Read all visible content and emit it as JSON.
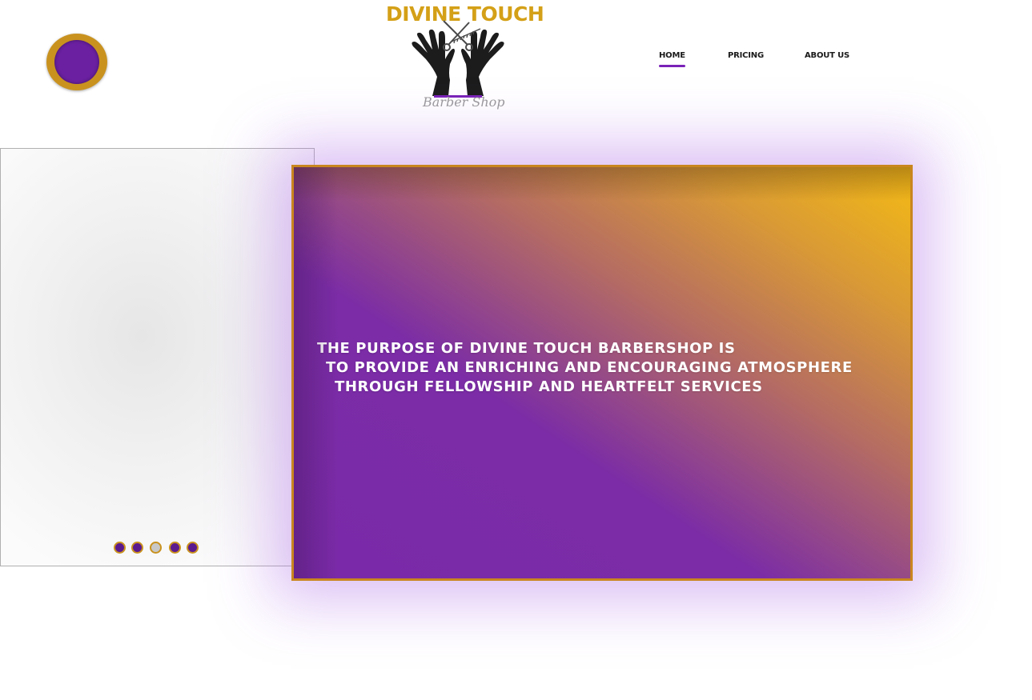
{
  "header": {
    "menu_button_icon": "circle-menu-icon",
    "logo": {
      "title": "DIVINE TOUCH",
      "subtitle": "Barber Shop",
      "icon": "hands-with-scissors-and-comb-icon"
    },
    "nav": {
      "items": [
        {
          "label": "HOME",
          "active": true
        },
        {
          "label": "PRICING",
          "active": false
        },
        {
          "label": "ABOUT US",
          "active": false
        }
      ]
    }
  },
  "slider": {
    "dots": [
      {
        "active": false
      },
      {
        "active": false
      },
      {
        "active": true
      },
      {
        "active": false
      },
      {
        "active": false
      }
    ]
  },
  "hero": {
    "lines": [
      "THE PURPOSE OF DIVINE TOUCH BARBERSHOP IS",
      "TO PROVIDE AN ENRICHING AND ENCOURAGING ATMOSPHERE",
      "THROUGH FELLOWSHIP AND HEARTFELT SERVICES"
    ]
  },
  "colors": {
    "purple": "#7a2aa8",
    "gold": "#d4a017",
    "nav_underline": "#7a22b8",
    "background": "#ffffff"
  }
}
